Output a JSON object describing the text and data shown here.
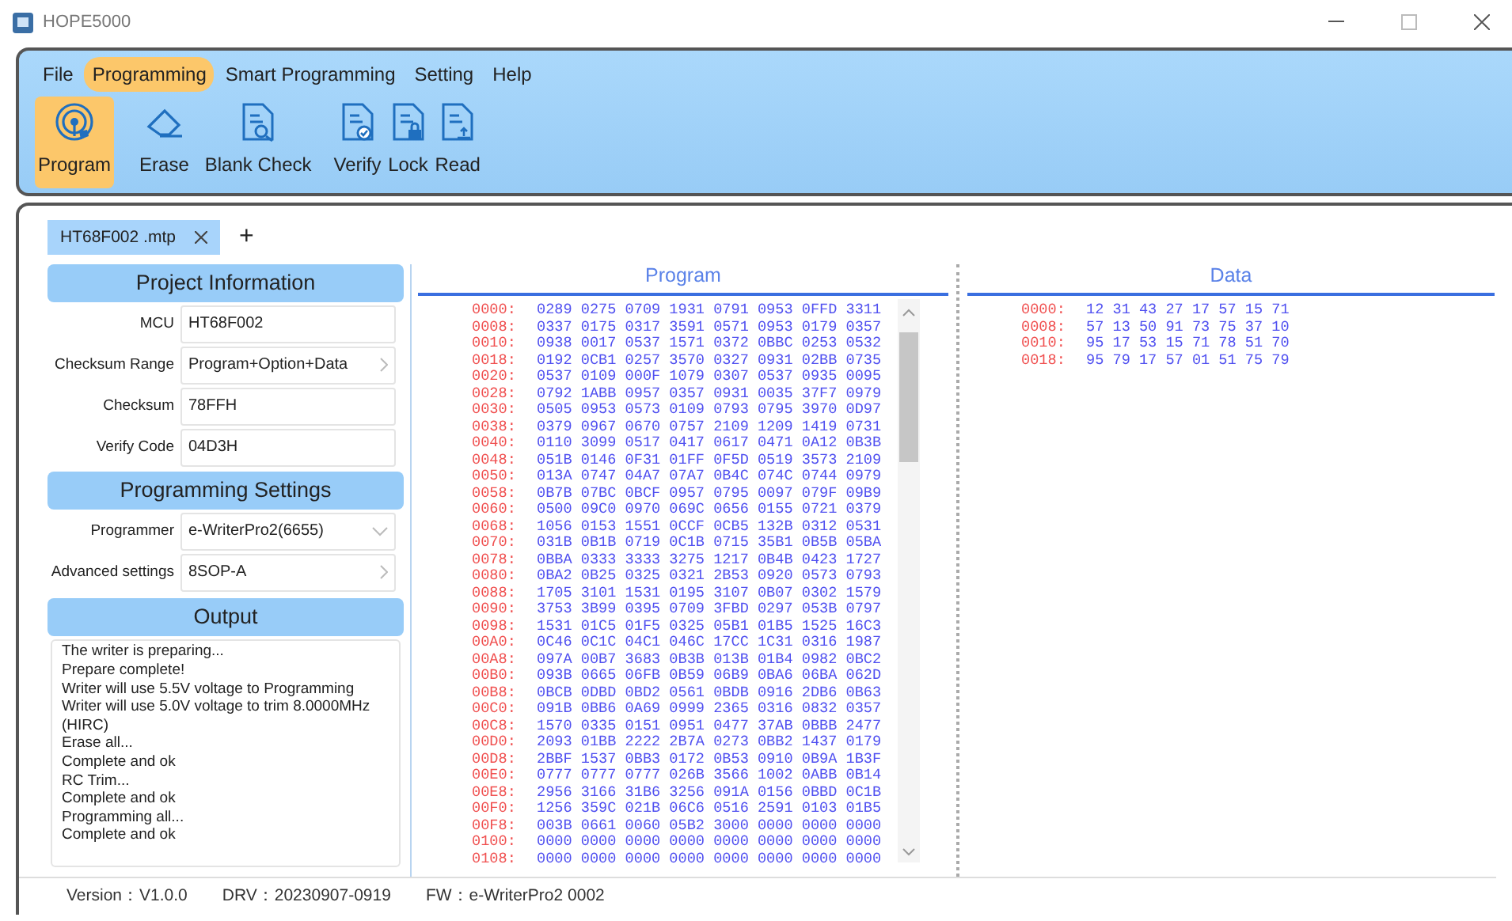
{
  "window": {
    "title": "HOPE5000"
  },
  "menu": [
    {
      "label": "File",
      "selected": false
    },
    {
      "label": "Programming",
      "selected": true
    },
    {
      "label": "Smart Programming",
      "selected": false
    },
    {
      "label": "Setting",
      "selected": false
    },
    {
      "label": "Help",
      "selected": false
    }
  ],
  "toolbar": [
    {
      "label": "Program",
      "kind": "program",
      "selected": true
    },
    {
      "label": "Erase",
      "kind": "erase",
      "selected": false
    },
    {
      "label": "Blank Check",
      "kind": "blank-check",
      "selected": false
    },
    {
      "label": "Verify",
      "kind": "verify",
      "selected": false
    },
    {
      "label": "Lock",
      "kind": "lock",
      "selected": false
    },
    {
      "label": "Read",
      "kind": "read",
      "selected": false
    }
  ],
  "file_tabs": [
    {
      "label": "HT68F002 .mtp",
      "selected": true
    }
  ],
  "new_tab": "+",
  "project_information": {
    "title": "Project Information",
    "fields": [
      {
        "label": "MCU",
        "value": "HT68F002",
        "kind": "text"
      },
      {
        "label": "Checksum Range",
        "value": "Program+Option+Data",
        "kind": "chevron"
      },
      {
        "label": "Checksum",
        "value": "78FFH",
        "kind": "text"
      },
      {
        "label": "Verify Code",
        "value": "04D3H",
        "kind": "text"
      }
    ]
  },
  "programming_settings": {
    "title": "Programming Settings",
    "fields": [
      {
        "label": "Programmer",
        "value": "e-WriterPro2(6655)",
        "kind": "dropdown"
      },
      {
        "label": "Advanced settings",
        "value": "8SOP-A",
        "kind": "chevron"
      }
    ]
  },
  "output": {
    "title": "Output",
    "lines": [
      "The writer is preparing...",
      "Prepare complete!",
      "Writer will use 5.5V voltage to Programming",
      "Writer will use 5.0V voltage to trim 8.0000MHz (HIRC)",
      "Erase all...",
      "Complete and ok",
      "RC Trim...",
      "Complete and ok",
      "Programming all...",
      "Complete and ok"
    ]
  },
  "program": {
    "title": "Program",
    "rows": [
      {
        "address": "0000:",
        "values": "0289 0275 0709 1931 0791 0953 0FFD 3311"
      },
      {
        "address": "0008:",
        "values": "0337 0175 0317 3591 0571 0953 0179 0357"
      },
      {
        "address": "0010:",
        "values": "0938 0017 0537 1571 0372 0BBC 0253 0532"
      },
      {
        "address": "0018:",
        "values": "0192 0CB1 0257 3570 0327 0931 02BB 0735"
      },
      {
        "address": "0020:",
        "values": "0537 0109 000F 1079 0307 0537 0935 0095"
      },
      {
        "address": "0028:",
        "values": "0792 1ABB 0957 0357 0931 0035 37F7 0979"
      },
      {
        "address": "0030:",
        "values": "0505 0953 0573 0109 0793 0795 3970 0D97"
      },
      {
        "address": "0038:",
        "values": "0379 0967 0670 0757 2109 1209 1419 0731"
      },
      {
        "address": "0040:",
        "values": "0110 3099 0517 0417 0617 0471 0A12 0B3B"
      },
      {
        "address": "0048:",
        "values": "051B 0146 0F31 01FF 0F5D 0519 3573 2109"
      },
      {
        "address": "0050:",
        "values": "013A 0747 04A7 07A7 0B4C 074C 0744 0979"
      },
      {
        "address": "0058:",
        "values": "0B7B 07BC 0BCF 0957 0795 0097 079F 09B9"
      },
      {
        "address": "0060:",
        "values": "0500 09C0 0970 069C 0656 0155 0721 0379"
      },
      {
        "address": "0068:",
        "values": "1056 0153 1551 0CCF 0CB5 132B 0312 0531"
      },
      {
        "address": "0070:",
        "values": "031B 0B1B 0719 0C1B 0715 35B1 0B5B 05BA"
      },
      {
        "address": "0078:",
        "values": "0BBA 0333 3333 3275 1217 0B4B 0423 1727"
      },
      {
        "address": "0080:",
        "values": "0BA2 0B25 0325 0321 2B53 0920 0573 0793"
      },
      {
        "address": "0088:",
        "values": "1705 3101 1531 0195 3107 0B07 0302 1579"
      },
      {
        "address": "0090:",
        "values": "3753 3B99 0395 0709 3FBD 0297 053B 0797"
      },
      {
        "address": "0098:",
        "values": "1531 01C5 01F5 0325 05B1 01B5 1525 16C3"
      },
      {
        "address": "00A0:",
        "values": "0C46 0C1C 04C1 046C 17CC 1C31 0316 1987"
      },
      {
        "address": "00A8:",
        "values": "097A 00B7 3683 0B3B 013B 01B4 0982 0BC2"
      },
      {
        "address": "00B0:",
        "values": "093B 0665 06FB 0B59 06B9 0BA6 06BA 062D"
      },
      {
        "address": "00B8:",
        "values": "0BCB 0DBD 0BD2 0561 0BDB 0916 2DB6 0B63"
      },
      {
        "address": "00C0:",
        "values": "091B 0BB6 0A69 0999 2365 0316 0832 0357"
      },
      {
        "address": "00C8:",
        "values": "1570 0335 0151 0951 0477 37AB 0BBB 2477"
      },
      {
        "address": "00D0:",
        "values": "2093 01BB 2222 2B7A 0273 0BB2 1437 0179"
      },
      {
        "address": "00D8:",
        "values": "2BBF 1537 0BB3 0172 0B53 0910 0B9A 1B3F"
      },
      {
        "address": "00E0:",
        "values": "0777 0777 0777 026B 3566 1002 0ABB 0B14"
      },
      {
        "address": "00E8:",
        "values": "2956 3166 31B6 3256 091A 0156 0BBD 0C1B"
      },
      {
        "address": "00F0:",
        "values": "1256 359C 021B 06C6 0516 2591 0103 01B5"
      },
      {
        "address": "00F8:",
        "values": "003B 0661 0060 05B2 3000 0000 0000 0000"
      },
      {
        "address": "0100:",
        "values": "0000 0000 0000 0000 0000 0000 0000 0000"
      },
      {
        "address": "0108:",
        "values": "0000 0000 0000 0000 0000 0000 0000 0000"
      }
    ]
  },
  "data": {
    "title": "Data",
    "rows": [
      {
        "address": "0000:",
        "values": "12 31 43 27 17 57 15 71"
      },
      {
        "address": "0008:",
        "values": "57 13 50 91 73 75 37 10"
      },
      {
        "address": "0010:",
        "values": "95 17 53 15 71 78 51 70"
      },
      {
        "address": "0018:",
        "values": "95 79 17 57 01 51 75 79"
      }
    ]
  },
  "status_bar": [
    "Version：V1.0.0",
    "DRV：20230907-0919",
    "FW：e-WriterPro2 0002"
  ]
}
